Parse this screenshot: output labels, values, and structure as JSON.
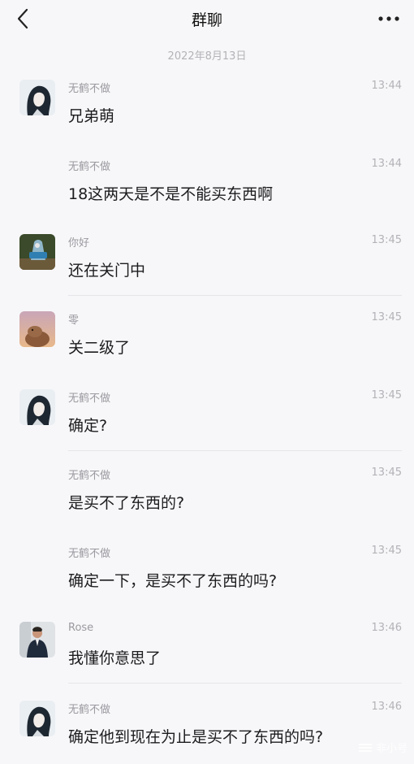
{
  "header": {
    "title": "群聊",
    "back_icon": "chevron-left-icon",
    "more_icon": "more-dots-icon"
  },
  "date_divider": "2022年8月13日",
  "messages": [
    {
      "sender": "无鹤不做",
      "time": "13:44",
      "text": "兄弟萌",
      "avatar": "girl-avatar"
    },
    {
      "sender": "无鹤不做",
      "time": "13:44",
      "text": "18这两天是不是不能买东西啊"
    },
    {
      "sender": "你好",
      "time": "13:45",
      "text": "还在关门中",
      "avatar": "toy-avatar"
    },
    {
      "sender": "零",
      "time": "13:45",
      "text": "关二级了",
      "avatar": "capybara-avatar"
    },
    {
      "sender": "无鹤不做",
      "time": "13:45",
      "text": "确定?",
      "avatar": "girl-avatar"
    },
    {
      "sender": "无鹤不做",
      "time": "13:45",
      "text": "是买不了东西的?"
    },
    {
      "sender": "无鹤不做",
      "time": "13:45",
      "text": "确定一下，是买不了东西的吗?"
    },
    {
      "sender": "Rose",
      "time": "13:46",
      "text": "我懂你意思了",
      "avatar": "man-suit-avatar"
    },
    {
      "sender": "无鹤不做",
      "time": "13:46",
      "text": "确定他到现在为止是买不了东西的吗?",
      "avatar": "girl-avatar"
    }
  ],
  "watermark": "非小号"
}
